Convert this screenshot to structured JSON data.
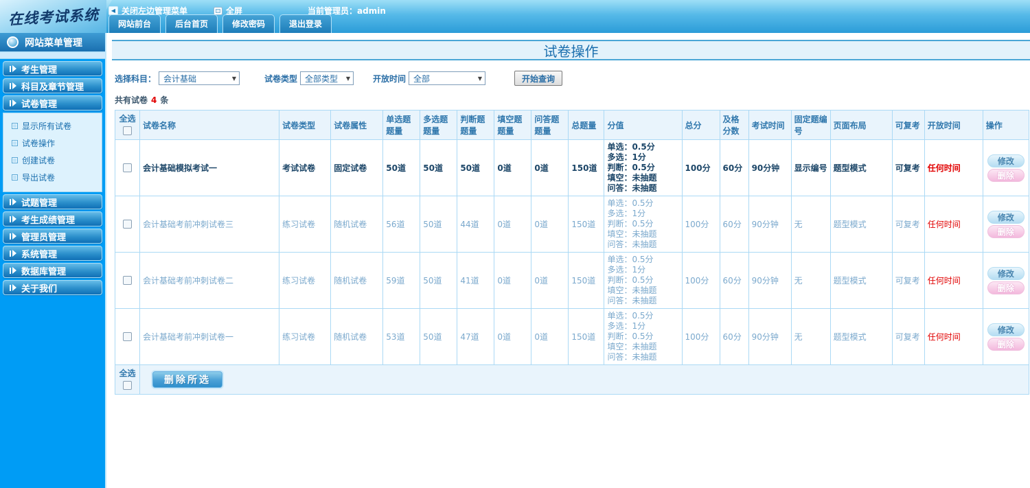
{
  "header": {
    "logo": "在线考试系统",
    "close_menu_label": "关闭左边管理菜单",
    "fullscreen_label": "全屏",
    "admin_label": "当前管理员：admin",
    "tabs": [
      "网站前台",
      "后台首页",
      "修改密码",
      "退出登录"
    ]
  },
  "sidebar": {
    "title": "网站菜单管理",
    "menus_top": [
      "考生管理",
      "科目及章节管理",
      "试卷管理"
    ],
    "submenu": [
      "显示所有试卷",
      "试卷操作",
      "创建试卷",
      "导出试卷"
    ],
    "menus_bottom": [
      "试题管理",
      "考生成绩管理",
      "管理员管理",
      "系统管理",
      "数据库管理",
      "关于我们"
    ]
  },
  "main": {
    "page_title": "试卷操作",
    "filters": {
      "subject_label": "选择科目：",
      "subject_value": "会计基础",
      "type_label": "试卷类型",
      "type_value": "全部类型",
      "open_label": "开放时间",
      "open_value": "全部",
      "search_button": "开始查询"
    },
    "count": {
      "prefix": "共有试卷",
      "value": "4",
      "suffix": "条"
    },
    "table": {
      "columns": [
        "全选",
        "试卷名称",
        "试卷类型",
        "试卷属性",
        "单选题题量",
        "多选题题量",
        "判断题题量",
        "填空题题量",
        "问答题题量",
        "总题量",
        "分值",
        "总分",
        "及格分数",
        "考试时间",
        "固定题编号",
        "页面布局",
        "可复考",
        "开放时间",
        "操作"
      ],
      "actions": {
        "edit": "修改",
        "delete": "删除"
      },
      "rows": [
        {
          "name": "会计基础模拟考试一",
          "type": "考试试卷",
          "attr": "固定试卷",
          "single": "50道",
          "multi": "50道",
          "judge": "50道",
          "blank": "0道",
          "qa": "0道",
          "total_questions": "150道",
          "score_detail": [
            "单选：0.5分",
            "多选：1分",
            "判断：0.5分",
            "填空：未抽题",
            "问答：未抽题"
          ],
          "total_score": "100分",
          "pass_score": "60分",
          "exam_time": "90分钟",
          "fixed_number": "显示编号",
          "page_layout": "题型模式",
          "retake": "可复考",
          "open_time": "任何时间",
          "emphasis": true
        },
        {
          "name": "会计基础考前冲刺试卷三",
          "type": "练习试卷",
          "attr": "随机试卷",
          "single": "56道",
          "multi": "50道",
          "judge": "44道",
          "blank": "0道",
          "qa": "0道",
          "total_questions": "150道",
          "score_detail": [
            "单选：0.5分",
            "多选：1分",
            "判断：0.5分",
            "填空：未抽题",
            "问答：未抽题"
          ],
          "total_score": "100分",
          "pass_score": "60分",
          "exam_time": "90分钟",
          "fixed_number": "无",
          "page_layout": "题型模式",
          "retake": "可复考",
          "open_time": "任何时间",
          "emphasis": false
        },
        {
          "name": "会计基础考前冲刺试卷二",
          "type": "练习试卷",
          "attr": "随机试卷",
          "single": "59道",
          "multi": "50道",
          "judge": "41道",
          "blank": "0道",
          "qa": "0道",
          "total_questions": "150道",
          "score_detail": [
            "单选：0.5分",
            "多选：1分",
            "判断：0.5分",
            "填空：未抽题",
            "问答：未抽题"
          ],
          "total_score": "100分",
          "pass_score": "60分",
          "exam_time": "90分钟",
          "fixed_number": "无",
          "page_layout": "题型模式",
          "retake": "可复考",
          "open_time": "任何时间",
          "emphasis": false
        },
        {
          "name": "会计基础考前冲刺试卷一",
          "type": "练习试卷",
          "attr": "随机试卷",
          "single": "53道",
          "multi": "50道",
          "judge": "47道",
          "blank": "0道",
          "qa": "0道",
          "total_questions": "150道",
          "score_detail": [
            "单选：0.5分",
            "多选：1分",
            "判断：0.5分",
            "填空：未抽题",
            "问答：未抽题"
          ],
          "total_score": "100分",
          "pass_score": "60分",
          "exam_time": "90分钟",
          "fixed_number": "无",
          "page_layout": "题型模式",
          "retake": "可复考",
          "open_time": "任何时间",
          "emphasis": false
        }
      ]
    },
    "footer": {
      "select_all": "全选",
      "delete_selected": "删除所选"
    }
  },
  "colors": {
    "sidebar_blue": "#009cf5",
    "accent_blue": "#1a7ab5",
    "table_border": "#abd9f5",
    "header_text": "#3178ad",
    "highlight_red": "#e10000",
    "pill_blue": "#b5ddf2",
    "pill_pink": "#f3b9dd"
  }
}
